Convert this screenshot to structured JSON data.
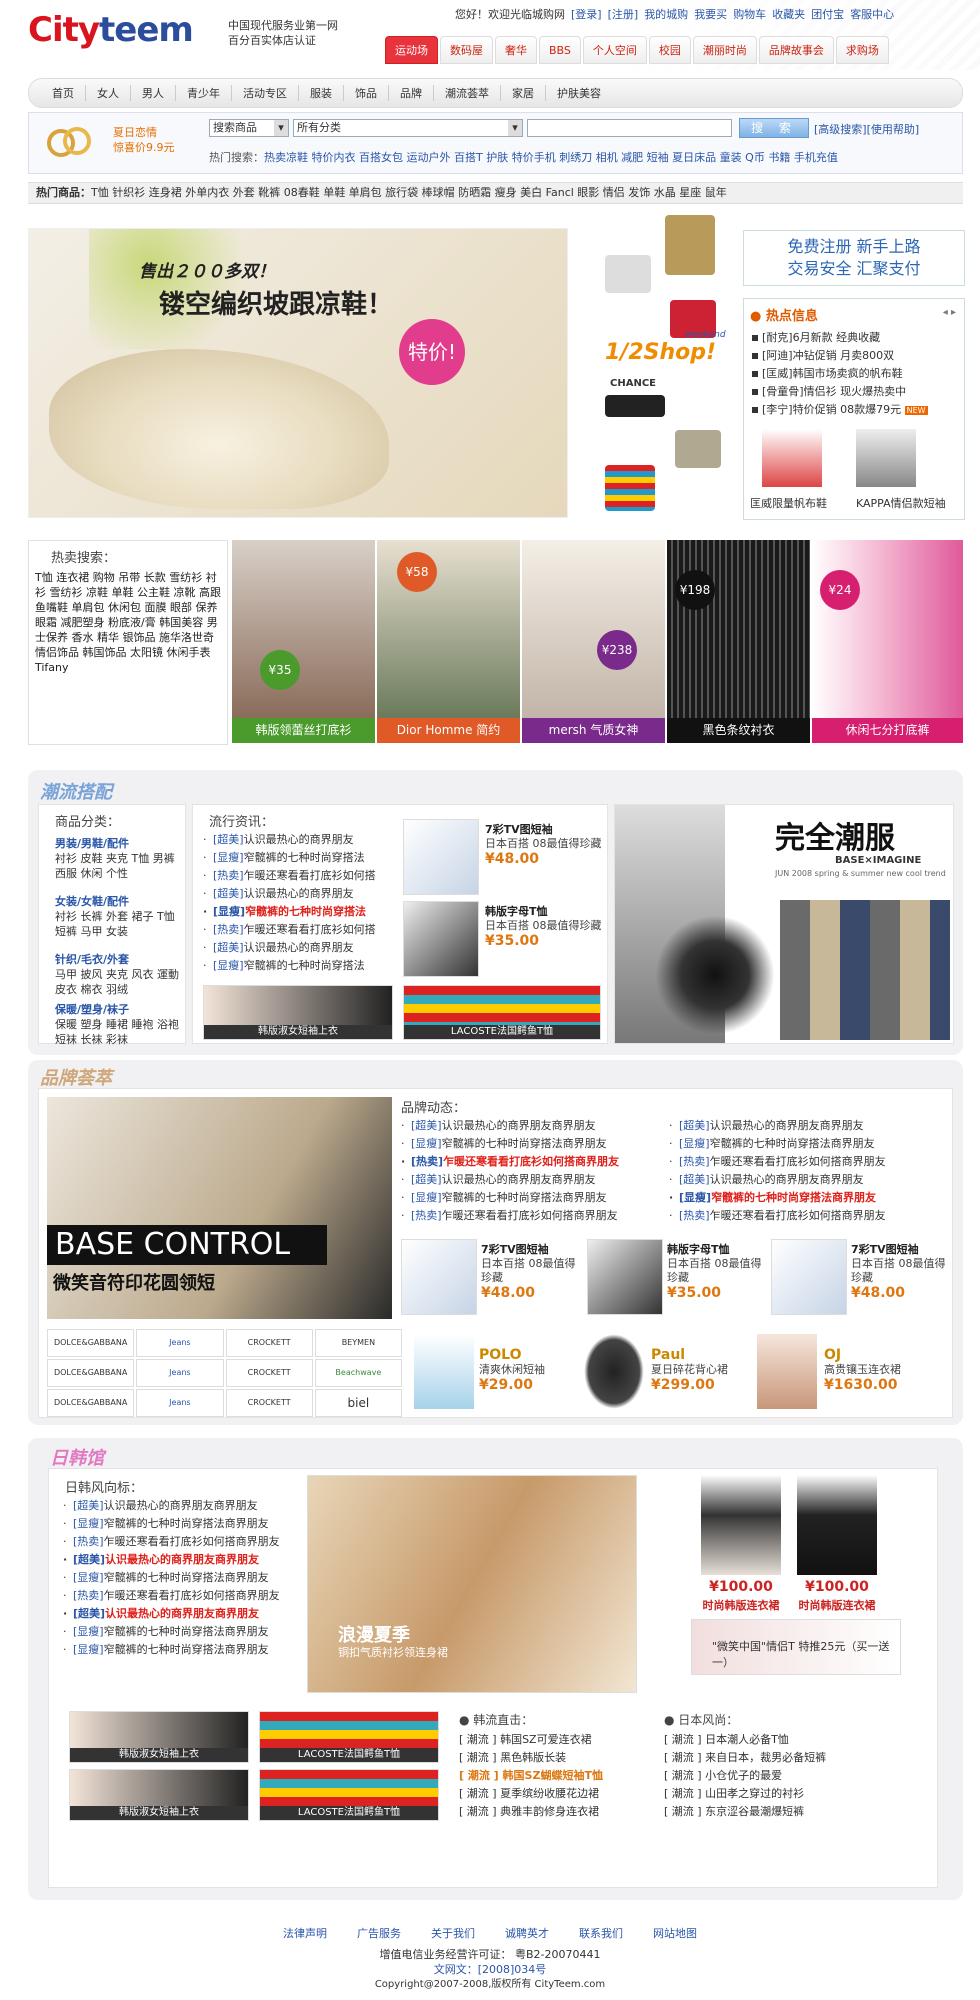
{
  "brand": {
    "logo_text": "Cityteem",
    "slogan_line1": "中国现代服务业第一网",
    "slogan_line2": "百分百实体店认证",
    "logo_color": "#d9141e",
    "accent": "#2b4d9c"
  },
  "top_links": [
    "您好！欢迎光临城购网",
    "[登录]",
    "[注册]",
    "我的城购",
    "我要买",
    "购物车",
    "收藏夹",
    "团付宝",
    "客服中心"
  ],
  "cat_tabs": [
    "运动场",
    "数码屋",
    "奢华",
    "BBS",
    "个人空间",
    "校园",
    "潮丽时尚",
    "品牌故事会",
    "求购场"
  ],
  "nav": [
    "首页",
    "女人",
    "男人",
    "青少年",
    "活动专区",
    "服装",
    "饰品",
    "品牌",
    "潮流荟萃",
    "家居",
    "护肤美容"
  ],
  "search": {
    "promo_line1": "夏日恋情",
    "promo_line2": "惊喜价9.9元",
    "select1": "搜索商品",
    "select2": "所有分类",
    "button": "搜 索",
    "advanced": "[高级搜索][使用帮助]",
    "hot_label": "热门搜索：",
    "hot_terms": "热卖凉鞋 特价内衣 百搭女包 运动户外 百搭T 护肤 特价手机 刺绣刀 相机 减肥 短袖 夏日床品 童装 Q币 书籍 手机充值"
  },
  "hot_items": {
    "label": "热门商品：",
    "items": "T恤 针织衫 连身裙 外单内衣 外套 靴裤 08春鞋 单鞋 单肩包 旅行袋 棒球帽 防晒霜 瘦身 美白 Fancl 眼影 情侣 发饰 水晶 星座 鼠年"
  },
  "banner": {
    "line1": "售出２００多双！",
    "line2": "镂空编织坡跟凉鞋！",
    "tag": "特价!",
    "half": "1/2Shop!",
    "sub": "weekend",
    "chance": "CHANCE"
  },
  "right_top": {
    "line1": "免费注册  新手上路",
    "line2": "交易安全  汇聚支付"
  },
  "hot_news": {
    "title": "热点信息",
    "items": [
      "[耐克]6月新款 经典收藏",
      "[阿迪]冲钻促销 月卖800双",
      "[匡威]韩国市场卖疯的帆布鞋",
      "[骨童骨]情侣衫 现火爆热卖中",
      "[李宁]特价促销 08款爆79元"
    ],
    "new_badge": "NEW",
    "thumbs": [
      "匡威限量帆布鞋",
      "KAPPA情侣款短袖"
    ]
  },
  "hot_search": {
    "title": "热卖搜索：",
    "words": "T恤 连衣裙 购物 吊带 长款 雪纺衫 衬衫 雪纺衫 凉鞋 单鞋 公主鞋 凉靴 高跟 鱼嘴鞋 单肩包 休闲包 面膜 眼部 保养 眼霜 减肥塑身 粉底液/膏 韩国美容 男士保养 香水 精华 银饰品 施华洛世奇 情侣饰品 韩国饰品 太阳镜 休闲手表 Tifany"
  },
  "products_top": [
    {
      "price": "¥35",
      "caption": "韩版领蕾丝打底衫",
      "bar": "#4a9a2c",
      "img": "#8a6c5a"
    },
    {
      "price": "¥58",
      "caption": "Dior Homme 简约",
      "bar": "#e05a28",
      "img": "#6a7a5a"
    },
    {
      "price": "¥238",
      "caption": "mersh 气质女神",
      "bar": "#7a2a8a",
      "img": "#c2b4a8"
    },
    {
      "price": "¥198",
      "caption": "黑色条纹衬衣",
      "bar": "#111111",
      "img": "#3a3a3a"
    },
    {
      "price": "¥24",
      "caption": "休闲七分打底裤",
      "bar": "#d6206f",
      "img": "#f1c0d4"
    }
  ],
  "trend": {
    "section": "潮流搭配",
    "cat_title": "商品分类：",
    "news_title": "流行资讯：",
    "cats": [
      {
        "t": "男装/男鞋/配件",
        "w": "衬衫 皮鞋 夹克 T恤 男裤 西服 休闲 个性"
      },
      {
        "t": "女装/女鞋/配件",
        "w": "衬衫 长裤 外套 裙子 T恤 短裤 马甲 女装"
      },
      {
        "t": "针织/毛衣/外套",
        "w": "马甲 披风 夹克 风衣 運動 皮衣 棉衣 羽绒"
      },
      {
        "t": "保暖/塑身/袜子",
        "w": "保暖 塑身 睡裙 睡袍 浴袍 短袜 长袜 彩袜"
      }
    ],
    "news": [
      {
        "c": "[超美]",
        "t": "认识最热心的商界朋友",
        "red": false
      },
      {
        "c": "[显瘦]",
        "t": "窄髋裤的七种时尚穿搭法",
        "red": false
      },
      {
        "c": "[热卖]",
        "t": "乍暖还寒看看打底衫如何搭",
        "red": false
      },
      {
        "c": "[超美]",
        "t": "认识最热心的商界朋友",
        "red": false
      },
      {
        "c": "[显瘦]",
        "t": "窄髋裤的七种时尚穿搭法",
        "red": true
      },
      {
        "c": "[热卖]",
        "t": "乍暖还寒看看打底衫如何搭",
        "red": false
      },
      {
        "c": "[超美]",
        "t": "认识最热心的商界朋友",
        "red": false
      },
      {
        "c": "[显瘦]",
        "t": "窄髋裤的七种时尚穿搭法",
        "red": false
      }
    ],
    "p1": {
      "n": "7彩TV图短袖",
      "d": "日本百搭 08最值得珍藏",
      "p": "¥48.00"
    },
    "p2": {
      "n": "韩版字母T恤",
      "d": "日本百搭 08最值得珍藏",
      "p": "¥35.00"
    },
    "b1": "韩版淑女短袖上衣",
    "b2": "LACOSTE法国鳄鱼T恤",
    "ad": {
      "t": "完全潮服",
      "sub": "BASE×IMAGINE",
      "small": "JUN 2008 spring & summer new cool trend"
    }
  },
  "brand_sec": {
    "section": "品牌荟萃",
    "banner_big": "BASE CONTROL",
    "banner_sub": "微笑音符印花圆领短",
    "news_title": "品牌动态：",
    "col1": [
      {
        "c": "[超美]",
        "t": "认识最热心的商界朋友商界朋友",
        "red": false
      },
      {
        "c": "[显瘦]",
        "t": "窄髋裤的七种时尚穿搭法商界朋友",
        "red": false
      },
      {
        "c": "[热卖]",
        "t": "乍暖还寒看看打底衫如何搭商界朋友",
        "red": true
      },
      {
        "c": "[超美]",
        "t": "认识最热心的商界朋友商界朋友",
        "red": false
      },
      {
        "c": "[显瘦]",
        "t": "窄髋裤的七种时尚穿搭法商界朋友",
        "red": false
      },
      {
        "c": "[热卖]",
        "t": "乍暖还寒看看打底衫如何搭商界朋友",
        "red": false
      }
    ],
    "col2": [
      {
        "c": "[超美]",
        "t": "认识最热心的商界朋友商界朋友",
        "red": false
      },
      {
        "c": "[显瘦]",
        "t": "窄髋裤的七种时尚穿搭法商界朋友",
        "red": false
      },
      {
        "c": "[热卖]",
        "t": "乍暖还寒看看打底衫如何搭商界朋友",
        "red": false
      },
      {
        "c": "[超美]",
        "t": "认识最热心的商界朋友商界朋友",
        "red": false
      },
      {
        "c": "[显瘦]",
        "t": "窄髋裤的七种时尚穿搭法商界朋友",
        "red": true
      },
      {
        "c": "[热卖]",
        "t": "乍暖还寒看看打底衫如何搭商界朋友",
        "red": false
      }
    ],
    "p1": {
      "n": "7彩TV图短袖",
      "d": "日本百搭 08最值得珍藏",
      "p": "¥48.00"
    },
    "p2": {
      "n": "韩版字母T恤",
      "d": "日本百搭 08最值得珍藏",
      "p": "¥35.00"
    },
    "p3": {
      "n": "7彩TV图短袖",
      "d": "日本百搭 08最值得珍藏",
      "p": "¥48.00"
    },
    "logos": [
      "DOLCE&GABBANA",
      "Jeans",
      "CROCKETT",
      "BEYMEN",
      "Beachwave",
      "biel"
    ],
    "q1": {
      "n": "POLO",
      "d": "清爽休闲短袖",
      "p": "¥29.00"
    },
    "q2": {
      "n": "Paul",
      "d": "夏日碎花背心裙",
      "p": "¥299.00"
    },
    "q3": {
      "n": "OJ",
      "d": "高贵镶玉连衣裙",
      "p": "¥1630.00"
    }
  },
  "jk_sec": {
    "section": "日韩馆",
    "title": "日韩风向标：",
    "news": [
      {
        "c": "[超美]",
        "t": "认识最热心的商界朋友商界朋友",
        "red": false
      },
      {
        "c": "[显瘦]",
        "t": "窄髋裤的七种时尚穿搭法商界朋友",
        "red": false
      },
      {
        "c": "[热卖]",
        "t": "乍暖还寒看看打底衫如何搭商界朋友",
        "red": false
      },
      {
        "c": "[超美]",
        "t": "认识最热心的商界朋友商界朋友",
        "red": true
      },
      {
        "c": "[显瘦]",
        "t": "窄髋裤的七种时尚穿搭法商界朋友",
        "red": false
      },
      {
        "c": "[热卖]",
        "t": "乍暖还寒看看打底衫如何搭商界朋友",
        "red": false
      },
      {
        "c": "[超美]",
        "t": "认识最热心的商界朋友商界朋友",
        "red": true
      },
      {
        "c": "[显瘦]",
        "t": "窄髋裤的七种时尚穿搭法商界朋友",
        "red": false
      },
      {
        "c": "[显瘦]",
        "t": "窄髋裤的七种时尚穿搭法商界朋友",
        "red": false
      }
    ],
    "banner_t": "浪漫夏季",
    "banner_s": "铜扣气质衬衫领连身裙",
    "d1": {
      "p": "¥100.00",
      "n": "时尚韩版连衣裙"
    },
    "d2": {
      "p": "¥100.00",
      "n": "时尚韩版连衣裙"
    },
    "promo": "\"微笑中国\"情侣T 特推25元（买一送一）",
    "b1": "韩版淑女短袖上衣",
    "b2": "LACOSTE法国鳄鱼T恤",
    "b3": "韩版淑女短袖上衣",
    "b4": "LACOSTE法国鳄鱼T恤",
    "korea_title": "韩流直击：",
    "japan_title": "日本风尚：",
    "korea": [
      "[ 潮流 ]  韩国SZ可爱连衣裙",
      "[ 潮流 ]  黑色韩版长装",
      "[ 潮流 ]  韩国SZ蝴蝶短袖T恤",
      "[ 潮流 ]  夏季缤纷收腰花边裙",
      "[ 潮流 ]  典雅丰韵修身连衣裙"
    ],
    "japan": [
      "[ 潮流 ]  日本潮人必备T恤",
      "[ 潮流 ]  来自日本，裁男必备短裤",
      "[ 潮流 ]  小仓优子的最爱",
      "[ 潮流 ]  山田孝之穿过的衬衫",
      "[ 潮流 ]  东京涩谷最潮爆短裤"
    ]
  },
  "footer": {
    "links": [
      "法律声明",
      "广告服务",
      "关于我们",
      "诚聘英才",
      "联系我们",
      "网站地图"
    ],
    "icp": "增值电信业务经营许可证： 粤B2-20070441",
    "wenwang": "文网文：[2008]034号",
    "copy": "Copyright@2007-2008,版权所有 CityTeem.com"
  }
}
